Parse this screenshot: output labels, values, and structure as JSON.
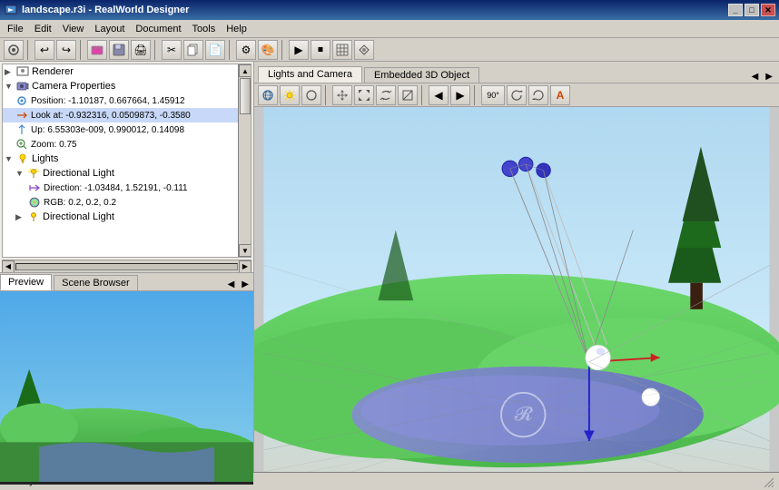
{
  "titlebar": {
    "title": "landscape.r3i - RealWorld Designer",
    "icon": "🖼",
    "buttons": [
      "_",
      "□",
      "✕"
    ]
  },
  "menubar": {
    "items": [
      "File",
      "Edit",
      "View",
      "Layout",
      "Document",
      "Tools",
      "Help"
    ]
  },
  "tabs": {
    "right": [
      {
        "label": "Lights and Camera",
        "active": true
      },
      {
        "label": "Embedded 3D Object",
        "active": false
      }
    ],
    "bottom": [
      {
        "label": "Preview",
        "active": true
      },
      {
        "label": "Scene Browser",
        "active": false
      }
    ]
  },
  "tree": {
    "items": [
      {
        "level": 0,
        "icon": "▶",
        "colorIcon": "🎥",
        "text": "Renderer"
      },
      {
        "level": 0,
        "icon": "▼",
        "colorIcon": "📷",
        "text": "Camera Properties"
      },
      {
        "level": 1,
        "icon": "",
        "colorIcon": "👁",
        "text": "Position: -1.10187, 0.667664, 1.45912"
      },
      {
        "level": 1,
        "icon": "",
        "colorIcon": "↗",
        "text": "Look at: -0.932316, 0.0509873, -0.3580"
      },
      {
        "level": 1,
        "icon": "",
        "colorIcon": "↑",
        "text": "Up: 6.55303e-009, 0.990012, 0.14098"
      },
      {
        "level": 1,
        "icon": "",
        "colorIcon": "🔍",
        "text": "Zoom: 0.75"
      },
      {
        "level": 0,
        "icon": "▼",
        "colorIcon": "💡",
        "text": "Lights"
      },
      {
        "level": 1,
        "icon": "▼",
        "colorIcon": "☀",
        "text": "Directional Light"
      },
      {
        "level": 2,
        "icon": "",
        "colorIcon": "✳",
        "text": "Direction: -1.03484, 1.52191, -0.111"
      },
      {
        "level": 2,
        "icon": "",
        "colorIcon": "🔵",
        "text": "RGB: 0.2, 0.2, 0.2"
      },
      {
        "level": 1,
        "icon": "▶",
        "colorIcon": "☀",
        "text": "Directional Light"
      }
    ]
  },
  "toolbar": {
    "buttons": [
      "🔍",
      "↩",
      "↺",
      "💾",
      "📂",
      "🖨",
      "✂",
      "📋",
      "📄",
      "⚙",
      "🎨",
      "▶",
      "⏹"
    ]
  },
  "right_toolbar": {
    "buttons": [
      "🌐",
      "💡",
      "○",
      "↔",
      "↕",
      "⤢",
      "⤡",
      "◀",
      "▶",
      "90°",
      "🔄",
      "🔃",
      "🅰"
    ]
  },
  "statusbar": {
    "text": "Ready"
  },
  "colors": {
    "grass": "#5dc85d",
    "water": "#7878c8",
    "sky_top": "#87ceeb",
    "sky_bottom": "#b0d8f0",
    "tree_dark": "#1a6b1a",
    "light_pin": "#4444cc"
  }
}
